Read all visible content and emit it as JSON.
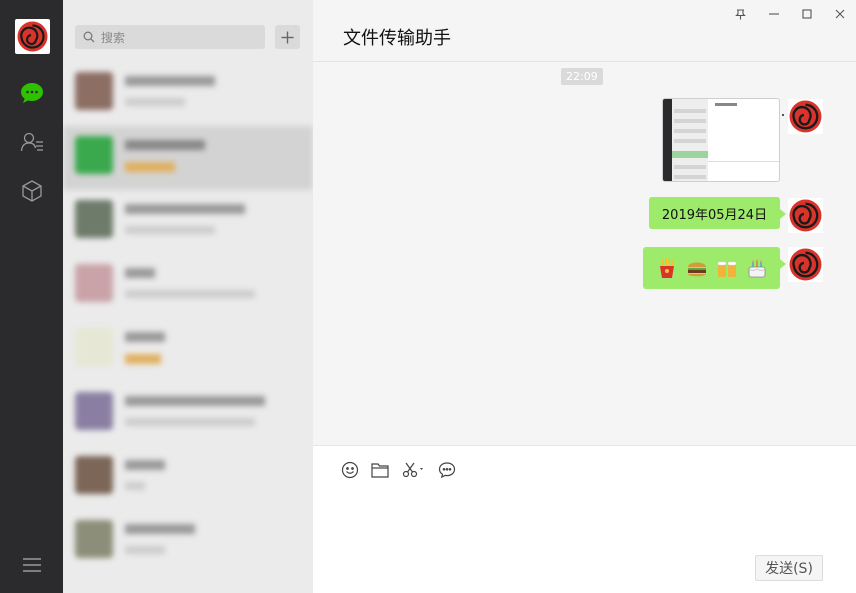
{
  "search": {
    "placeholder": "搜索"
  },
  "chat": {
    "title": "文件传输助手",
    "time_label": "22:09",
    "date_message": "2019年05月24日",
    "emoji_names": [
      "fries-icon",
      "burger-icon",
      "beer-icon",
      "cake-icon"
    ]
  },
  "composer": {
    "send_label": "发送(S)"
  },
  "colors": {
    "nav_bg": "#2b2b2d",
    "bubble_green": "#9eea6a",
    "chat_bg": "#f5f5f5",
    "active_chat_icon": "#2dc100"
  }
}
